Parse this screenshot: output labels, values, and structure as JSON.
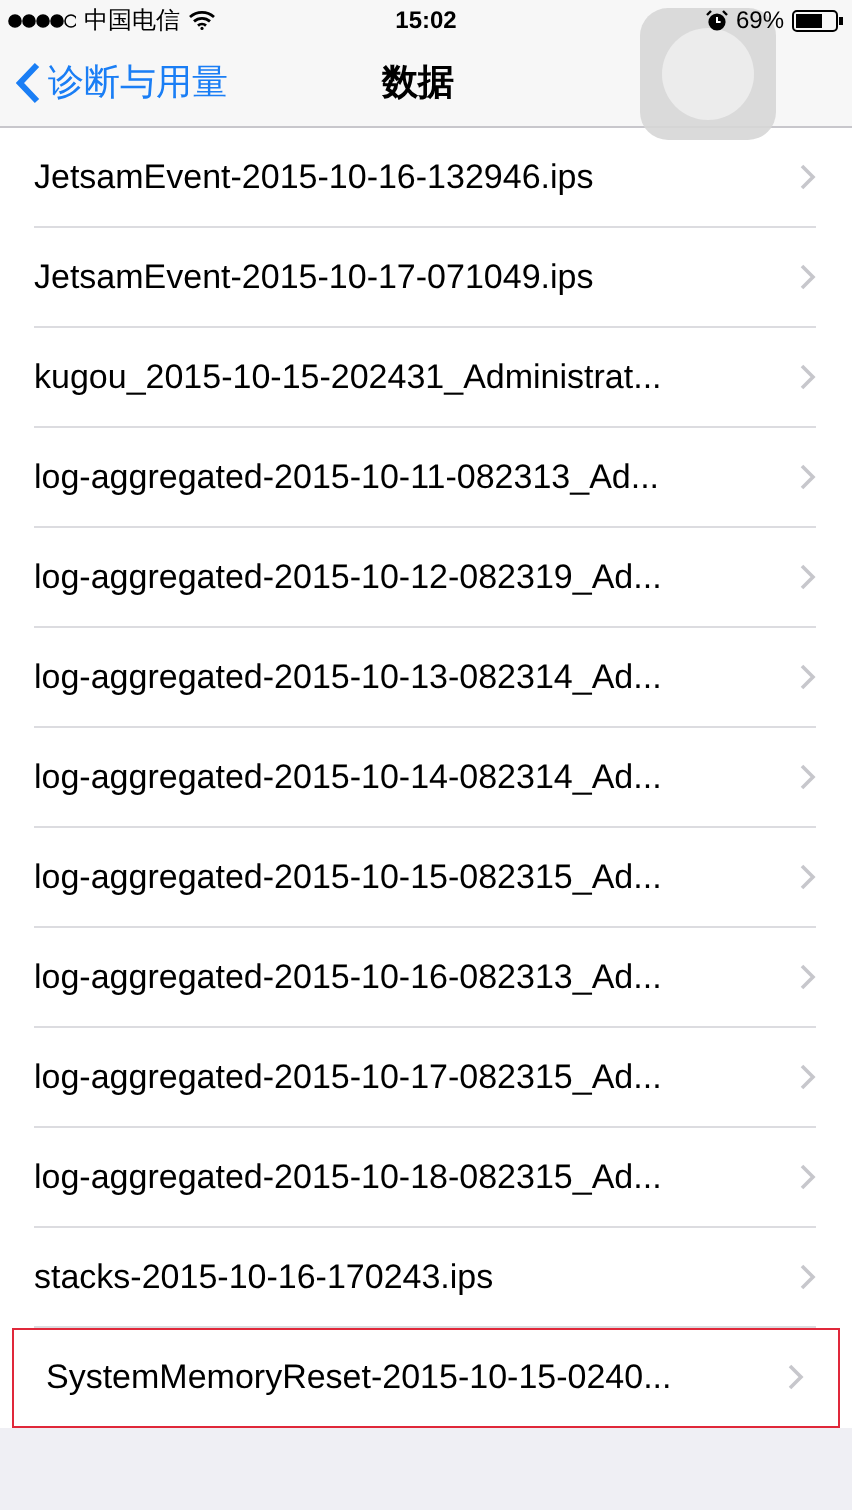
{
  "status_bar": {
    "carrier": "中国电信",
    "time": "15:02",
    "battery": "69%"
  },
  "nav": {
    "back": "诊断与用量",
    "title": "数据"
  },
  "rows": [
    {
      "label": "JetsamEvent-2015-10-16-132946.ips",
      "highlighted": false
    },
    {
      "label": "JetsamEvent-2015-10-17-071049.ips",
      "highlighted": false
    },
    {
      "label": "kugou_2015-10-15-202431_Administrat...",
      "highlighted": false
    },
    {
      "label": "log-aggregated-2015-10-11-082313_Ad...",
      "highlighted": false
    },
    {
      "label": "log-aggregated-2015-10-12-082319_Ad...",
      "highlighted": false
    },
    {
      "label": "log-aggregated-2015-10-13-082314_Ad...",
      "highlighted": false
    },
    {
      "label": "log-aggregated-2015-10-14-082314_Ad...",
      "highlighted": false
    },
    {
      "label": "log-aggregated-2015-10-15-082315_Ad...",
      "highlighted": false
    },
    {
      "label": "log-aggregated-2015-10-16-082313_Ad...",
      "highlighted": false
    },
    {
      "label": "log-aggregated-2015-10-17-082315_Ad...",
      "highlighted": false
    },
    {
      "label": "log-aggregated-2015-10-18-082315_Ad...",
      "highlighted": false
    },
    {
      "label": "stacks-2015-10-16-170243.ips",
      "highlighted": false
    },
    {
      "label": "SystemMemoryReset-2015-10-15-0240...",
      "highlighted": true
    }
  ]
}
